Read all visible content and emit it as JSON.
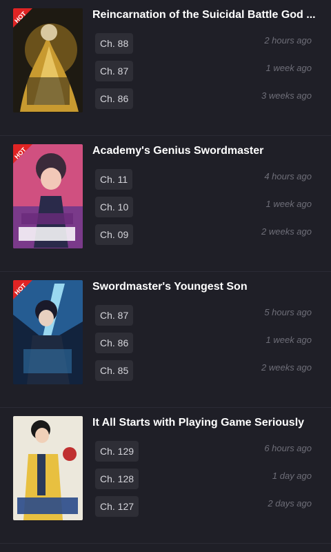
{
  "badge_label": "HOT",
  "series": [
    {
      "title": "Reincarnation of the Suicidal Battle God ...",
      "hot": true,
      "cover_colors": [
        "#2a2418",
        "#b8902a",
        "#f0d070"
      ],
      "chapters": [
        {
          "label": "Ch. 88",
          "time": "2 hours ago"
        },
        {
          "label": "Ch. 87",
          "time": "1 week ago"
        },
        {
          "label": "Ch. 86",
          "time": "3 weeks ago"
        }
      ]
    },
    {
      "title": "Academy's Genius Swordmaster",
      "hot": true,
      "cover_colors": [
        "#c8507a",
        "#5a2a4a",
        "#f2c0b0"
      ],
      "chapters": [
        {
          "label": "Ch. 11",
          "time": "4 hours ago"
        },
        {
          "label": "Ch. 10",
          "time": "1 week ago"
        },
        {
          "label": "Ch. 09",
          "time": "2 weeks ago"
        }
      ]
    },
    {
      "title": "Swordmaster's Youngest Son",
      "hot": true,
      "cover_colors": [
        "#1a3a6a",
        "#3a8ac8",
        "#9ad8f0"
      ],
      "chapters": [
        {
          "label": "Ch. 87",
          "time": "5 hours ago"
        },
        {
          "label": "Ch. 86",
          "time": "1 week ago"
        },
        {
          "label": "Ch. 85",
          "time": "2 weeks ago"
        }
      ]
    },
    {
      "title": "It All Starts with Playing Game Seriously",
      "hot": false,
      "cover_colors": [
        "#e8e4d8",
        "#e8c040",
        "#2a3a5a"
      ],
      "chapters": [
        {
          "label": "Ch. 129",
          "time": "6 hours ago"
        },
        {
          "label": "Ch. 128",
          "time": "1 day ago"
        },
        {
          "label": "Ch. 127",
          "time": "2 days ago"
        }
      ]
    }
  ]
}
